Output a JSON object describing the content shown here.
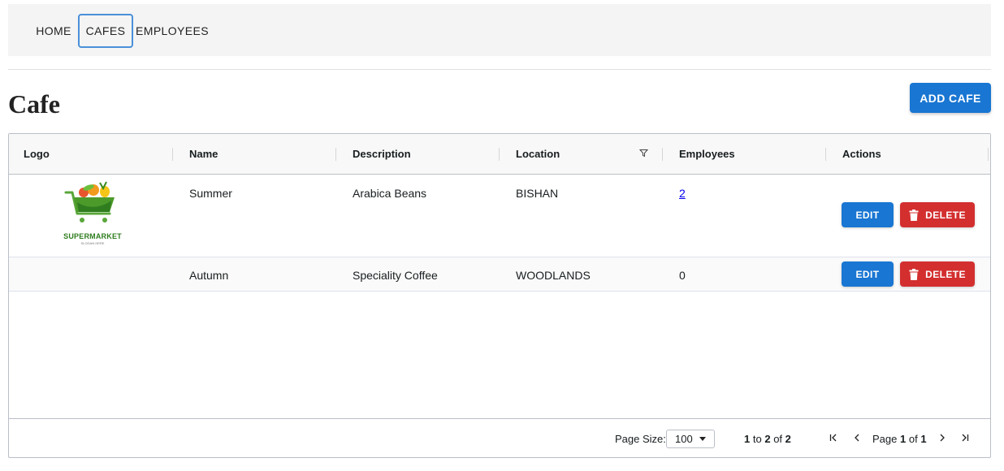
{
  "nav": {
    "home": "HOME",
    "cafes": "CAFES",
    "employees": "EMPLOYEES"
  },
  "page": {
    "title": "Cafe",
    "add_button": "ADD CAFE"
  },
  "grid": {
    "columns": [
      "Logo",
      "Name",
      "Description",
      "Location",
      "Employees",
      "Actions"
    ],
    "rows": [
      {
        "logo_text": "SUPERMARKET",
        "logo_sub": "SLOGAN HERE",
        "name": "Summer",
        "description": "Arabica Beans",
        "location": "BISHAN",
        "employees": "2"
      },
      {
        "logo_text": "",
        "name": "Autumn",
        "description": "Speciality Coffee",
        "location": "WOODLANDS",
        "employees": "0"
      }
    ],
    "actions": {
      "edit": "EDIT",
      "delete": "DELETE"
    }
  },
  "pagination": {
    "page_size_label": "Page Size:",
    "page_size": "100",
    "from": "1",
    "to_word": "to",
    "to": "2",
    "of_word": "of",
    "total": "2",
    "page_word": "Page",
    "current_page": "1",
    "of_word2": "of",
    "total_pages": "1"
  },
  "colors": {
    "primary": "#1976d2",
    "danger": "#d32f2f",
    "active_outline": "#4a90d9"
  }
}
